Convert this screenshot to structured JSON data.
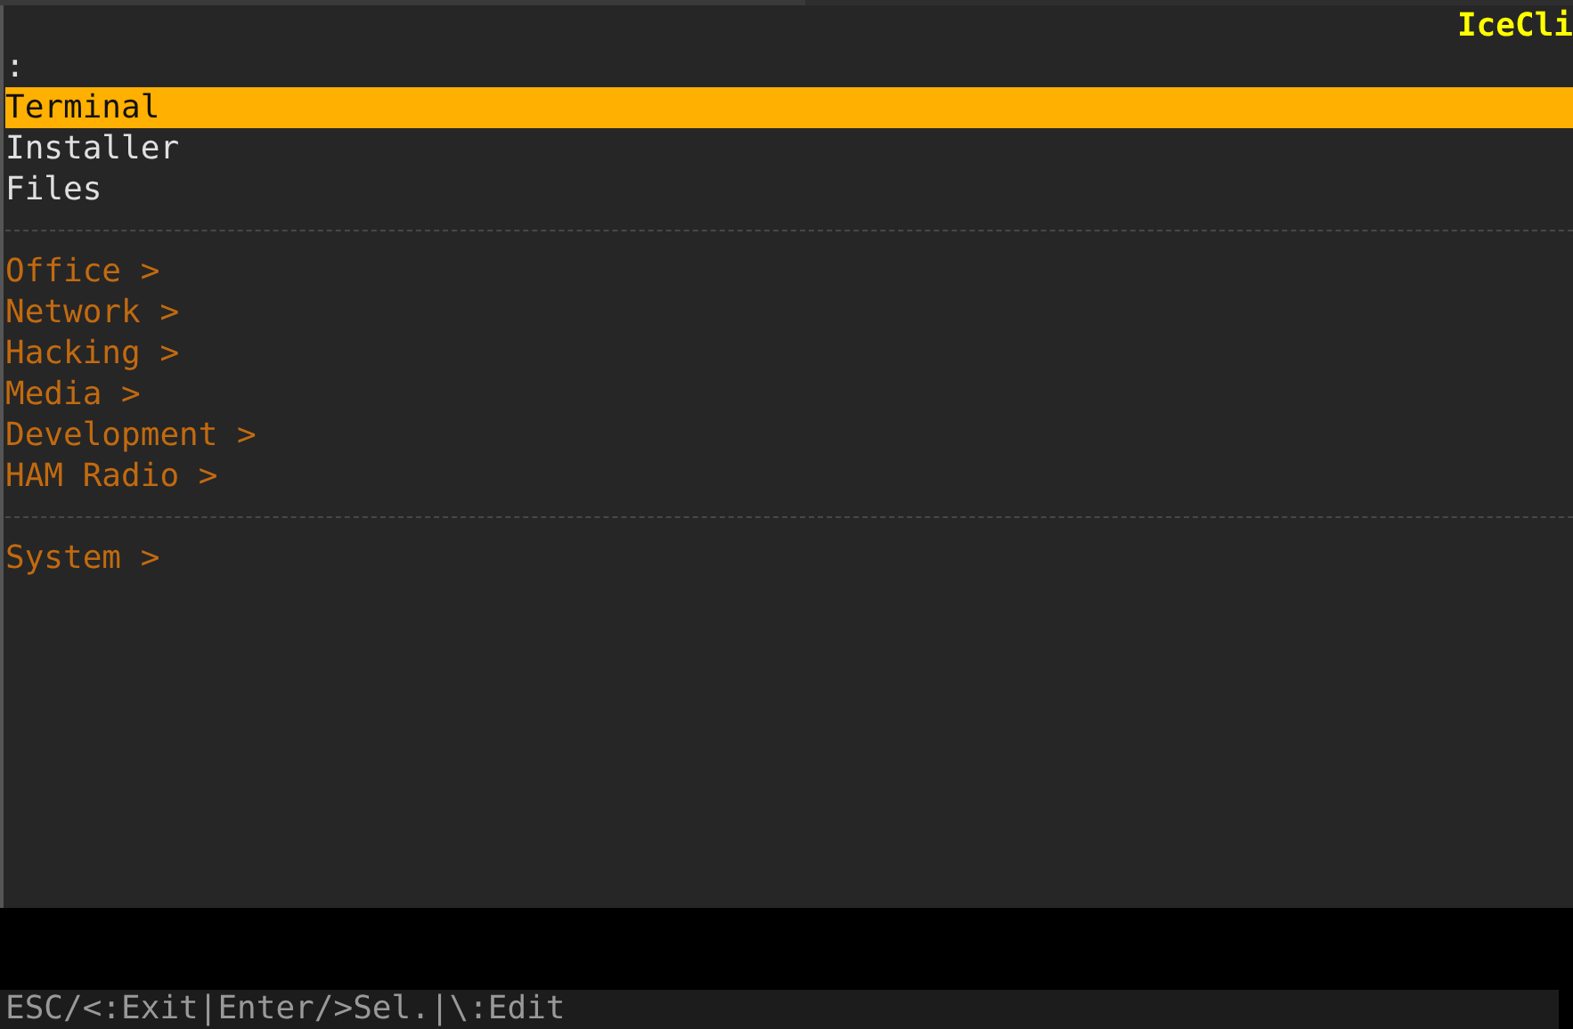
{
  "title": "IceCli",
  "prompt": ":",
  "groups": [
    {
      "items": [
        {
          "label": "Terminal",
          "kind": "app",
          "selected": true
        },
        {
          "label": "Installer",
          "kind": "app",
          "selected": false
        },
        {
          "label": "Files",
          "kind": "app",
          "selected": false
        }
      ]
    },
    {
      "items": [
        {
          "label": "Office >",
          "kind": "category",
          "selected": false
        },
        {
          "label": "Network >",
          "kind": "category",
          "selected": false
        },
        {
          "label": "Hacking >",
          "kind": "category",
          "selected": false
        },
        {
          "label": "Media >",
          "kind": "category",
          "selected": false
        },
        {
          "label": "Development >",
          "kind": "category",
          "selected": false
        },
        {
          "label": "HAM Radio >",
          "kind": "category",
          "selected": false
        }
      ]
    },
    {
      "items": [
        {
          "label": "System >",
          "kind": "category",
          "selected": false
        }
      ]
    }
  ],
  "status_bar": "ESC/<:Exit|Enter/>Sel.|\\:Edit"
}
